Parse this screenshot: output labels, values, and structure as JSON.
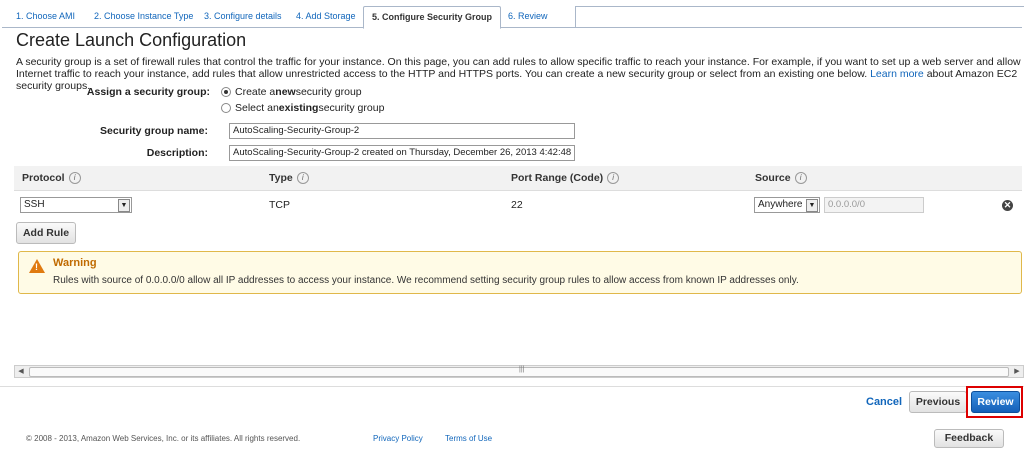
{
  "wizard": {
    "steps": [
      "1. Choose AMI",
      "2. Choose Instance Type",
      "3. Configure details",
      "4. Add Storage",
      "5. Configure Security Group",
      "6. Review"
    ],
    "active_step": "5. Configure Security Group"
  },
  "page": {
    "title": "Create Launch Configuration",
    "intro": "A security group is a set of firewall rules that control the traffic for your instance. On this page, you can add rules to allow specific traffic to reach your instance. For example, if you want to set up a web server and allow Internet traffic to reach your instance, add rules that allow unrestricted access to the HTTP and HTTPS ports. You can create a new security group or select from an existing one below.",
    "learn_more": "Learn more",
    "intro_tail": "about Amazon EC2 security groups."
  },
  "security_group": {
    "assign_label": "Assign a security group:",
    "option_new_pre": "Create a ",
    "option_new_bold": "new",
    "option_new_post": " security group",
    "option_existing_pre": "Select an ",
    "option_existing_bold": "existing",
    "option_existing_post": " security group",
    "selected": "new",
    "name_label": "Security group name:",
    "name_value": "AutoScaling-Security-Group-2",
    "description_label": "Description:",
    "description_value": "AutoScaling-Security-Group-2 created on Thursday, December 26, 2013 4:42:48 PM"
  },
  "rules_table": {
    "headers": [
      "Protocol",
      "Type",
      "Port Range (Code)",
      "Source"
    ],
    "info_glyph": "i",
    "rows": [
      {
        "protocol": "SSH",
        "type": "TCP",
        "port_range": "22",
        "source": "Anywhere",
        "cidr": "0.0.0.0/0"
      }
    ],
    "add_rule": "Add Rule"
  },
  "warning": {
    "title": "Warning",
    "message": "Rules with source of 0.0.0.0/0 allow all IP addresses to access your instance. We recommend setting security group rules to allow access from known IP addresses only."
  },
  "actions": {
    "cancel": "Cancel",
    "previous": "Previous",
    "review": "Review"
  },
  "footer": {
    "copyright": "© 2008 - 2013, Amazon Web Services, Inc. or its affiliates. All rights reserved.",
    "privacy": "Privacy Policy",
    "terms": "Terms of Use",
    "feedback": "Feedback"
  },
  "colors": {
    "accent": "#1166bb",
    "warning": "#e07a10",
    "highlight": "#dd0000"
  }
}
